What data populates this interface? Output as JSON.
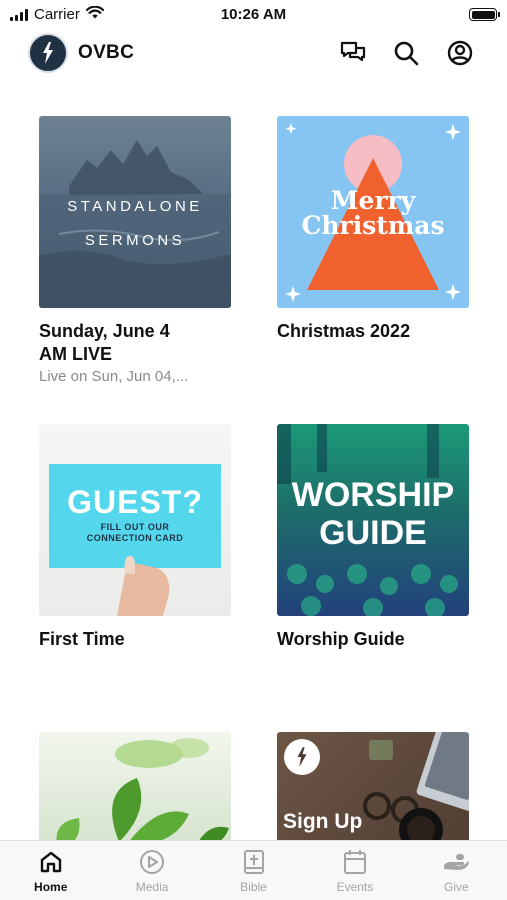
{
  "status_bar": {
    "carrier": "Carrier",
    "time": "10:26 AM",
    "icons": [
      "signal-icon",
      "wifi-icon",
      "battery-icon"
    ]
  },
  "header": {
    "title": "OVBC",
    "icons": [
      "chat-icon",
      "search-icon",
      "account-icon"
    ]
  },
  "grid": {
    "items": [
      {
        "title": "Sunday, June 4\nAM LIVE",
        "subtitle": "Live on Sun, Jun 04,...",
        "thumb_text": "STANDALONE\nSERMONS"
      },
      {
        "title": "Christmas 2022",
        "subtitle": "",
        "thumb_text": "Merry\nChristmas",
        "colors": {
          "background": "#86c4f1",
          "circle": "#f7bdc5",
          "triangle": "#f0612d"
        }
      },
      {
        "title": "First Time",
        "subtitle": "",
        "thumb_text": "GUEST?",
        "thumb_subtext": "FILL OUT OUR\nCONNECTION CARD"
      },
      {
        "title": "Worship Guide",
        "subtitle": "",
        "thumb_text": "WORSHIP\nGUIDE"
      },
      {
        "title": "",
        "subtitle": "",
        "thumb_text": ""
      },
      {
        "title": "",
        "subtitle": "",
        "thumb_text": "Sign Up"
      }
    ]
  },
  "tab_bar": {
    "active": "Home",
    "tabs": [
      {
        "label": "Home",
        "icon": "home-icon"
      },
      {
        "label": "Media",
        "icon": "play-circle-icon"
      },
      {
        "label": "Bible",
        "icon": "bible-icon"
      },
      {
        "label": "Events",
        "icon": "calendar-icon"
      },
      {
        "label": "Give",
        "icon": "give-icon"
      }
    ]
  }
}
